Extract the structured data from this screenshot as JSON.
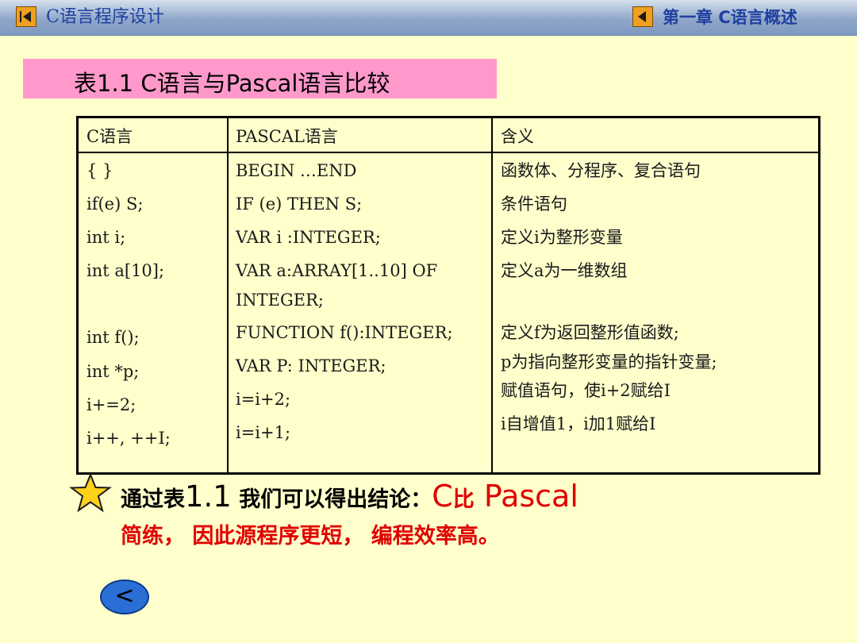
{
  "header": {
    "left_title": "C语言程序设计",
    "right_title": "第一章 C语言概述"
  },
  "caption": "表1.1  C语言与Pascal语言比较",
  "table": {
    "headers": [
      "C语言",
      "PASCAL语言",
      "含义"
    ],
    "c_col": [
      "{   }",
      "if(e) S;",
      "int i;",
      "int a[10];",
      "int f();",
      "int *p;",
      "i+=2;",
      "i++, ++I;"
    ],
    "pascal_col": [
      "BEGIN …END",
      "IF (e) THEN  S;",
      "VAR i :INTEGER;",
      "VAR a:ARRAY[1..10] OF",
      "INTEGER;",
      "FUNCTION f():INTEGER;",
      "VAR  P: INTEGER;",
      "i=i+2;",
      "i=i+1;"
    ],
    "meaning_col": [
      "函数体、分程序、复合语句",
      "条件语句",
      "定义i为整形变量",
      "定义a为一维数组",
      "定义f为返回整形值函数;",
      "p为指向整形变量的指针变量;",
      "赋值语句，使i+2赋给I",
      "i自增值1，i加1赋给I"
    ]
  },
  "conclusion": {
    "line1_prefix": "通过表",
    "line1_num": "1.1",
    "line1_mid": " 我们可以得出结论：",
    "line1_red": "C",
    "line1_red_zh": "比",
    "line1_red_end": " Pascal",
    "line2": "简练， 因此源程序更短， 编程效率高。"
  },
  "nav": {
    "back_label": "<"
  }
}
